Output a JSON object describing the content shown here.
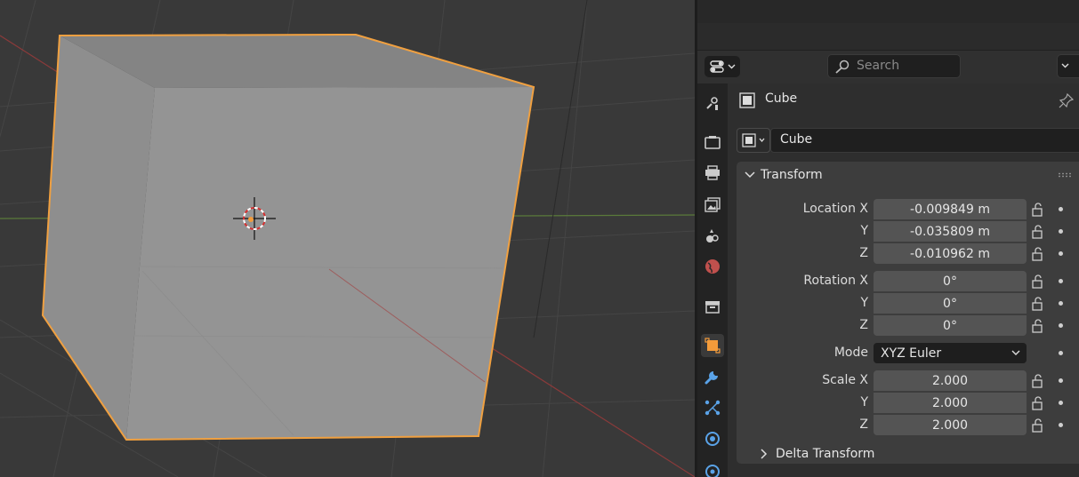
{
  "colors": {
    "viewport_bg": "#393939",
    "panel_bg": "#3d3d3d",
    "field_bg": "#545454",
    "selection_outline": "#f0a040",
    "object_orange": "#f39b3a",
    "tab_blue": "#5aa3e8"
  },
  "header": {
    "search_placeholder": "Search"
  },
  "tabs": [
    {
      "name": "tool-icon"
    },
    {
      "name": "render-icon"
    },
    {
      "name": "output-icon"
    },
    {
      "name": "view-layer-icon"
    },
    {
      "name": "scene-icon"
    },
    {
      "name": "world-icon"
    },
    {
      "name": "collection-icon"
    },
    {
      "name": "object-icon",
      "active": true
    },
    {
      "name": "modifier-wrench-icon"
    },
    {
      "name": "particles-icon"
    },
    {
      "name": "physics-icon"
    },
    {
      "name": "constraints-icon"
    }
  ],
  "object": {
    "title": "Cube",
    "name": "Cube"
  },
  "transform": {
    "title": "Transform",
    "location": {
      "label_x": "Location X",
      "label_y": "Y",
      "label_z": "Z",
      "x": "-0.009849 m",
      "y": "-0.035809 m",
      "z": "-0.010962 m"
    },
    "rotation": {
      "label_x": "Rotation X",
      "label_y": "Y",
      "label_z": "Z",
      "x": "0°",
      "y": "0°",
      "z": "0°"
    },
    "mode": {
      "label": "Mode",
      "value": "XYZ Euler"
    },
    "scale": {
      "label_x": "Scale X",
      "label_y": "Y",
      "label_z": "Z",
      "x": "2.000",
      "y": "2.000",
      "z": "2.000"
    }
  },
  "delta_transform": {
    "title": "Delta Transform"
  }
}
